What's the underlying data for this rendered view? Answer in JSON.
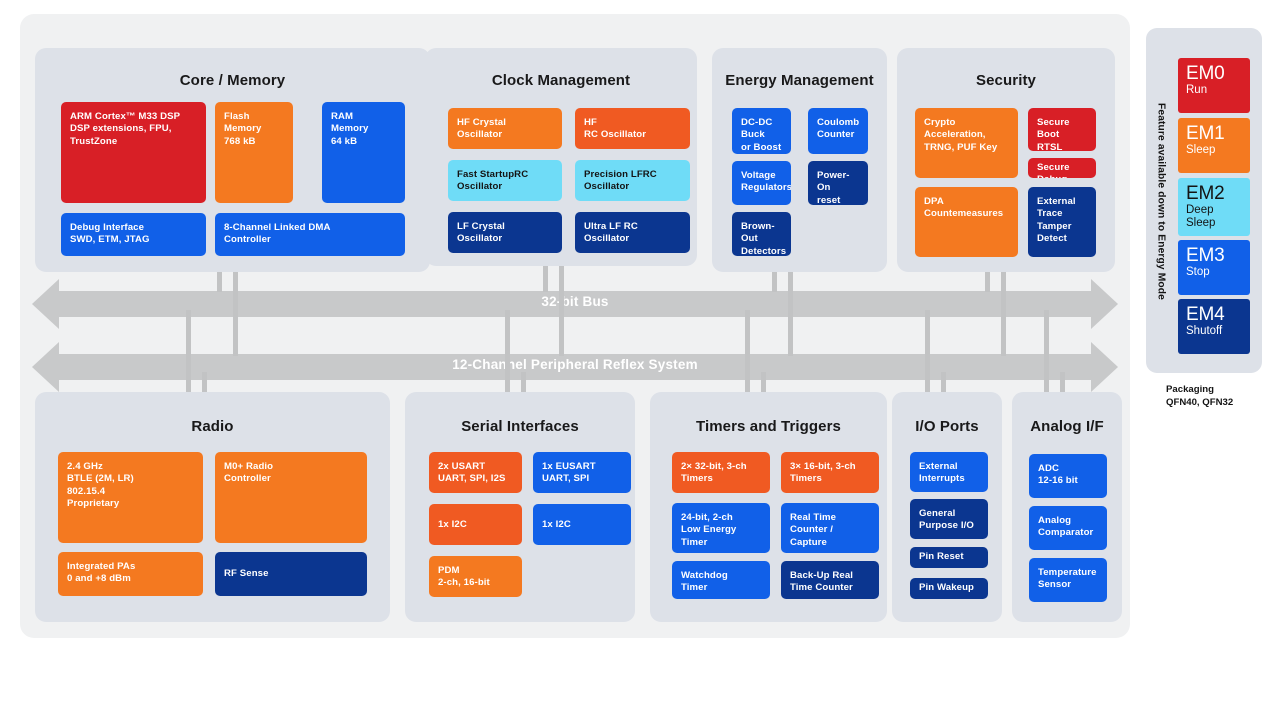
{
  "diagram": {
    "buses": [
      {
        "label": "32-bit Bus"
      },
      {
        "label": "12-Channel Peripheral Reflex System"
      }
    ],
    "packaging": "Packaging\nQFN40, QFN32",
    "energy_rail": {
      "axis_label": "Feature available down to Energy Mode",
      "modes": [
        {
          "name": "EM0",
          "sub": "Run",
          "color": "#d81f26",
          "text": "light"
        },
        {
          "name": "EM1",
          "sub": "Sleep",
          "color": "#f47920",
          "text": "light"
        },
        {
          "name": "EM2",
          "sub": "Deep\nSleep",
          "color": "#6fdcf7",
          "text": "dark"
        },
        {
          "name": "EM3",
          "sub": "Stop",
          "color": "#1160e8",
          "text": "light"
        },
        {
          "name": "EM4",
          "sub": "Shutoff",
          "color": "#0b3690",
          "text": "light"
        }
      ]
    },
    "sections": [
      {
        "title": "Core / Memory",
        "blocks": [
          {
            "label": "ARM Cortex™ M33 DSP\nDSP extensions, FPU,\nTrustZone",
            "color": "#d81f26",
            "text": "light"
          },
          {
            "label": "Flash\nMemory\n768 kB",
            "color": "#f47920",
            "text": "light"
          },
          {
            "label": "RAM\nMemory\n64 kB",
            "color": "#1160e8",
            "text": "light"
          },
          {
            "label": "Debug Interface\nSWD, ETM, JTAG",
            "color": "#1160e8",
            "text": "light"
          },
          {
            "label": "8-Channel Linked DMA\nController",
            "color": "#1160e8",
            "text": "light"
          }
        ]
      },
      {
        "title": "Clock Management",
        "blocks": [
          {
            "label": "HF Crystal\nOscillator",
            "color": "#f47920",
            "text": "light"
          },
          {
            "label": "HF\nRC Oscillator",
            "color": "#f05a22",
            "text": "light"
          },
          {
            "label": "Fast StartupRC\nOscillator",
            "color": "#6fdcf7",
            "text": "dark"
          },
          {
            "label": "Precision LFRC\nOscillator",
            "color": "#6fdcf7",
            "text": "dark"
          },
          {
            "label": "LF Crystal\nOscillator",
            "color": "#0b3690",
            "text": "light"
          },
          {
            "label": "Ultra LF RC\nOscillator",
            "color": "#0b3690",
            "text": "light"
          }
        ]
      },
      {
        "title": "Energy Management",
        "blocks": [
          {
            "label": "DC-DC\nBuck\nor Boost",
            "color": "#1160e8",
            "text": "light"
          },
          {
            "label": "Coulomb\nCounter",
            "color": "#1160e8",
            "text": "light"
          },
          {
            "label": "Voltage\nRegulators",
            "color": "#1160e8",
            "text": "light"
          },
          {
            "label": "Power-On\nreset",
            "color": "#0b3690",
            "text": "light"
          },
          {
            "label": "Brown-Out\nDetectors",
            "color": "#0b3690",
            "text": "light"
          }
        ]
      },
      {
        "title": "Security",
        "blocks": [
          {
            "label": "Crypto\nAcceleration,\nTRNG, PUF Key",
            "color": "#f47920",
            "text": "light"
          },
          {
            "label": "Secure Boot\nRTSL",
            "color": "#d81f26",
            "text": "light"
          },
          {
            "label": "Secure Debug",
            "color": "#d81f26",
            "text": "light"
          },
          {
            "label": "DPA\nCountemeasures",
            "color": "#f47920",
            "text": "light"
          },
          {
            "label": "External Trace\nTamper Detect",
            "color": "#0b3690",
            "text": "light"
          }
        ]
      },
      {
        "title": "Radio",
        "blocks": [
          {
            "label": "2.4 GHz\nBTLE (2M, LR)\n802.15.4\nProprietary",
            "color": "#f47920",
            "text": "light"
          },
          {
            "label": "M0+ Radio\nController",
            "color": "#f47920",
            "text": "light"
          },
          {
            "label": "Integrated PAs\n0 and +8 dBm",
            "color": "#f47920",
            "text": "light"
          },
          {
            "label": "RF Sense",
            "color": "#0b3690",
            "text": "light"
          }
        ]
      },
      {
        "title": "Serial Interfaces",
        "blocks": [
          {
            "label": "2x USART\nUART, SPI, I2S",
            "color": "#f05a22",
            "text": "light"
          },
          {
            "label": "1x EUSART\nUART, SPI",
            "color": "#1160e8",
            "text": "light"
          },
          {
            "label": "1x I2C",
            "color": "#f05a22",
            "text": "light"
          },
          {
            "label": "1x I2C",
            "color": "#1160e8",
            "text": "light"
          },
          {
            "label": "PDM\n2-ch, 16-bit",
            "color": "#f47920",
            "text": "light"
          }
        ]
      },
      {
        "title": "Timers and Triggers",
        "blocks": [
          {
            "label": "2× 32-bit, 3-ch\nTimers",
            "color": "#f05a22",
            "text": "light"
          },
          {
            "label": "3× 16-bit, 3-ch\nTimers",
            "color": "#f05a22",
            "text": "light"
          },
          {
            "label": "24-bit, 2-ch\nLow Energy\nTimer",
            "color": "#1160e8",
            "text": "light"
          },
          {
            "label": "Real Time\nCounter /\nCapture",
            "color": "#1160e8",
            "text": "light"
          },
          {
            "label": "Watchdog\nTimer",
            "color": "#1160e8",
            "text": "light"
          },
          {
            "label": "Back-Up Real\nTime Counter",
            "color": "#0b3690",
            "text": "light"
          }
        ]
      },
      {
        "title": "I/O Ports",
        "blocks": [
          {
            "label": "External\nInterrupts",
            "color": "#1160e8",
            "text": "light"
          },
          {
            "label": "General\nPurpose I/O",
            "color": "#0b3690",
            "text": "light"
          },
          {
            "label": "Pin Reset",
            "color": "#0b3690",
            "text": "light"
          },
          {
            "label": "Pin Wakeup",
            "color": "#0b3690",
            "text": "light"
          }
        ]
      },
      {
        "title": "Analog I/F",
        "blocks": [
          {
            "label": "ADC\n12-16 bit",
            "color": "#1160e8",
            "text": "light"
          },
          {
            "label": "Analog\nComparator",
            "color": "#1160e8",
            "text": "light"
          },
          {
            "label": "Temperature\nSensor",
            "color": "#1160e8",
            "text": "light"
          }
        ]
      }
    ]
  }
}
